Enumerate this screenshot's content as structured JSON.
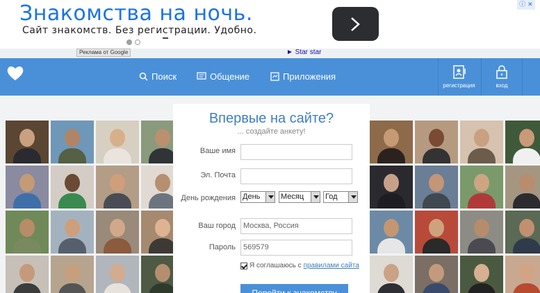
{
  "ad": {
    "title": "Знакомства на ночь.",
    "subtitle": "Сайт знакомств. Без регистрации. Удобно.",
    "ads_by_google": "Реклама от Google",
    "link_text": "► Star star",
    "next_icon": "chevron-right-icon",
    "info_icon": "ad-choices-icon",
    "colors": {
      "title": "#1a73e8",
      "button": "#2b2d31"
    }
  },
  "nav": {
    "logo_icon": "heart-icon",
    "items": [
      {
        "label": "Поиск",
        "icon": "search-icon"
      },
      {
        "label": "Общение",
        "icon": "chat-icon"
      },
      {
        "label": "Приложения",
        "icon": "apps-icon"
      }
    ],
    "register_label": "регистрация",
    "login_label": "вход",
    "background": "#4a90d9"
  },
  "form": {
    "title": "Впервые на сайте?",
    "subtitle": "... создайте анкету!",
    "name_label": "Ваше имя",
    "name_value": "",
    "email_label": "Эл. Почта",
    "email_value": "",
    "dob_label": "День рождения",
    "day_selected": "День",
    "month_selected": "Месяц",
    "year_selected": "Год",
    "city_label": "Ваш город",
    "city_value": "Москва, Россия",
    "password_label": "Пароль",
    "password_value": "569579",
    "agree_text": "Я соглашаюсь с",
    "rules_link": "правилами сайта",
    "agree_checked": true,
    "submit_label": "Перейти к знакомству"
  }
}
